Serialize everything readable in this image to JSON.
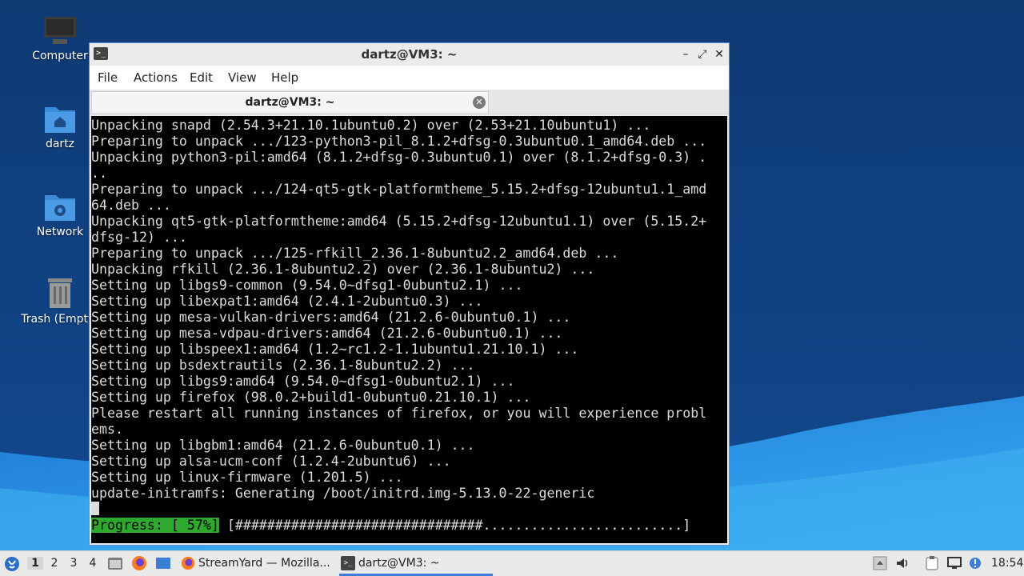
{
  "desktop": {
    "icons": [
      {
        "label": "Computer"
      },
      {
        "label": "dartz"
      },
      {
        "label": "Network"
      },
      {
        "label": "Trash (Empty)"
      }
    ]
  },
  "window": {
    "title": "dartz@VM3: ~",
    "menu": [
      "File",
      "Actions",
      "Edit",
      "View",
      "Help"
    ],
    "tab_label": "dartz@VM3: ~",
    "controls": {
      "minimize": "–",
      "maximize": "⤢",
      "close": "✕"
    }
  },
  "terminal": {
    "lines": [
      "Unpacking snapd (2.54.3+21.10.1ubuntu0.2) over (2.53+21.10ubuntu1) ...",
      "Preparing to unpack .../123-python3-pil_8.1.2+dfsg-0.3ubuntu0.1_amd64.deb ...",
      "Unpacking python3-pil:amd64 (8.1.2+dfsg-0.3ubuntu0.1) over (8.1.2+dfsg-0.3) .",
      "..",
      "Preparing to unpack .../124-qt5-gtk-platformtheme_5.15.2+dfsg-12ubuntu1.1_amd",
      "64.deb ...",
      "Unpacking qt5-gtk-platformtheme:amd64 (5.15.2+dfsg-12ubuntu1.1) over (5.15.2+",
      "dfsg-12) ...",
      "Preparing to unpack .../125-rfkill_2.36.1-8ubuntu2.2_amd64.deb ...",
      "Unpacking rfkill (2.36.1-8ubuntu2.2) over (2.36.1-8ubuntu2) ...",
      "Setting up libgs9-common (9.54.0~dfsg1-0ubuntu2.1) ...",
      "Setting up libexpat1:amd64 (2.4.1-2ubuntu0.3) ...",
      "Setting up mesa-vulkan-drivers:amd64 (21.2.6-0ubuntu0.1) ...",
      "Setting up mesa-vdpau-drivers:amd64 (21.2.6-0ubuntu0.1) ...",
      "Setting up libspeex1:amd64 (1.2~rc1.2-1.1ubuntu1.21.10.1) ...",
      "Setting up bsdextrautils (2.36.1-8ubuntu2.2) ...",
      "Setting up libgs9:amd64 (9.54.0~dfsg1-0ubuntu2.1) ...",
      "Setting up firefox (98.0.2+build1-0ubuntu0.21.10.1) ...",
      "Please restart all running instances of firefox, or you will experience probl",
      "ems.",
      "Setting up libgbm1:amd64 (21.2.6-0ubuntu0.1) ...",
      "Setting up alsa-ucm-conf (1.2.4-2ubuntu6) ...",
      "Setting up linux-firmware (1.201.5) ...",
      "update-initramfs: Generating /boot/initrd.img-5.13.0-22-generic"
    ],
    "progress_label": "Progress: [ 57%]",
    "progress_bar": " [###############################.........................]",
    "progress_percent": 57
  },
  "taskbar": {
    "workspaces": [
      "1",
      "2",
      "3",
      "4"
    ],
    "active_workspace": "1",
    "tasks": [
      {
        "label": "StreamYard — Mozilla..."
      },
      {
        "label": "dartz@VM3: ~"
      }
    ],
    "clock": "18:54"
  },
  "colors": {
    "desktop_dark": "#0f3d7a",
    "desktop_wave": "#2f9ce8",
    "progress_green": "#2ea82e",
    "window_border": "#5a8fd6",
    "active_task_underline": "#3d7bd6"
  }
}
